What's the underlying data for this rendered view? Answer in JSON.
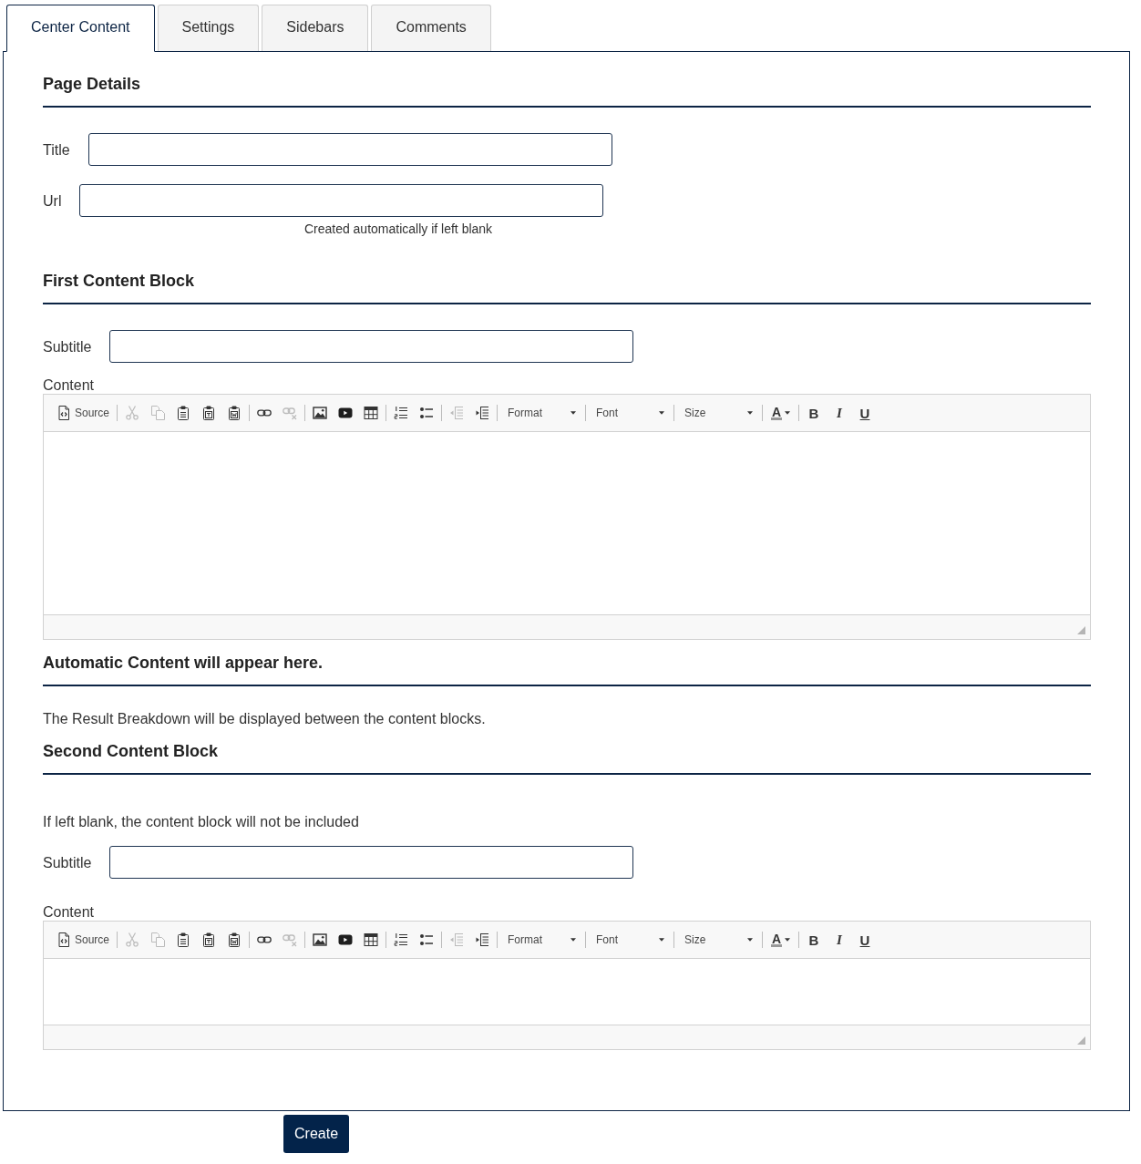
{
  "tabs": [
    {
      "label": "Center Content",
      "selected": true
    },
    {
      "label": "Settings",
      "selected": false
    },
    {
      "label": "Sidebars",
      "selected": false
    },
    {
      "label": "Comments",
      "selected": false
    }
  ],
  "sections": [
    {
      "kind": "heading",
      "text": "Page Details"
    },
    {
      "kind": "field",
      "label": "Title"
    },
    {
      "kind": "field",
      "label": "Url",
      "help": "Created automatically if left blank"
    },
    {
      "kind": "heading",
      "text": "First Content Block"
    },
    {
      "kind": "field",
      "label": "Subtitle"
    },
    {
      "kind": "editor",
      "label": "Content",
      "toolbar": [
        [
          {
            "kind": "source",
            "label": "Source",
            "disabled": false
          }
        ],
        [
          {
            "kind": "cut",
            "disabled": true
          },
          {
            "kind": "copy",
            "disabled": true
          },
          {
            "kind": "paste",
            "disabled": false
          },
          {
            "kind": "pastetext",
            "disabled": false
          },
          {
            "kind": "pasteword",
            "disabled": false
          }
        ],
        [
          {
            "kind": "link",
            "disabled": false
          },
          {
            "kind": "unlink",
            "disabled": true
          }
        ],
        [
          {
            "kind": "image",
            "disabled": false
          },
          {
            "kind": "video",
            "disabled": false
          },
          {
            "kind": "table",
            "disabled": false
          }
        ],
        [
          {
            "kind": "numberedlist",
            "disabled": false
          },
          {
            "kind": "bulletedlist",
            "disabled": false
          }
        ],
        [
          {
            "kind": "outdent",
            "disabled": true
          },
          {
            "kind": "indent",
            "disabled": false
          }
        ],
        [
          {
            "kind": "combo",
            "label": "Format",
            "disabled": false
          }
        ],
        [
          {
            "kind": "combo",
            "label": "Font",
            "disabled": false
          }
        ],
        [
          {
            "kind": "combo",
            "label": "Size",
            "disabled": false
          }
        ],
        [
          {
            "kind": "textcolor",
            "label": "A",
            "disabled": false
          }
        ],
        [
          {
            "kind": "bold",
            "label": "B",
            "disabled": false
          },
          {
            "kind": "italic",
            "label": "I",
            "disabled": false
          },
          {
            "kind": "underline",
            "label": "U",
            "disabled": false
          }
        ]
      ]
    },
    {
      "kind": "heading",
      "text": "Automatic Content will appear here."
    },
    {
      "kind": "note",
      "text": "The Result Breakdown will be displayed between the content blocks."
    },
    {
      "kind": "heading",
      "text": "Second Content Block"
    },
    {
      "kind": "note",
      "text": "If left blank, the content block will not be included"
    },
    {
      "kind": "field",
      "label": "Subtitle"
    },
    {
      "kind": "editor",
      "label": "Content",
      "toolbar": [
        [
          {
            "kind": "source",
            "label": "Source",
            "disabled": false
          }
        ],
        [
          {
            "kind": "cut",
            "disabled": true
          },
          {
            "kind": "copy",
            "disabled": true
          },
          {
            "kind": "paste",
            "disabled": false
          },
          {
            "kind": "pastetext",
            "disabled": false
          },
          {
            "kind": "pasteword",
            "disabled": false
          }
        ],
        [
          {
            "kind": "link",
            "disabled": false
          },
          {
            "kind": "unlink",
            "disabled": true
          }
        ],
        [
          {
            "kind": "image",
            "disabled": false
          },
          {
            "kind": "video",
            "disabled": false
          },
          {
            "kind": "table",
            "disabled": false
          }
        ],
        [
          {
            "kind": "numberedlist",
            "disabled": false
          },
          {
            "kind": "bulletedlist",
            "disabled": false
          }
        ],
        [
          {
            "kind": "outdent",
            "disabled": true
          },
          {
            "kind": "indent",
            "disabled": false
          }
        ],
        [
          {
            "kind": "combo",
            "label": "Format",
            "disabled": false
          }
        ],
        [
          {
            "kind": "combo",
            "label": "Font",
            "disabled": false
          }
        ],
        [
          {
            "kind": "combo",
            "label": "Size",
            "disabled": false
          }
        ],
        [
          {
            "kind": "textcolor",
            "label": "A",
            "disabled": false
          }
        ],
        [
          {
            "kind": "bold",
            "label": "B",
            "disabled": false
          },
          {
            "kind": "italic",
            "label": "I",
            "disabled": false
          },
          {
            "kind": "underline",
            "label": "U",
            "disabled": false
          }
        ]
      ]
    }
  ],
  "create_button": "Create"
}
